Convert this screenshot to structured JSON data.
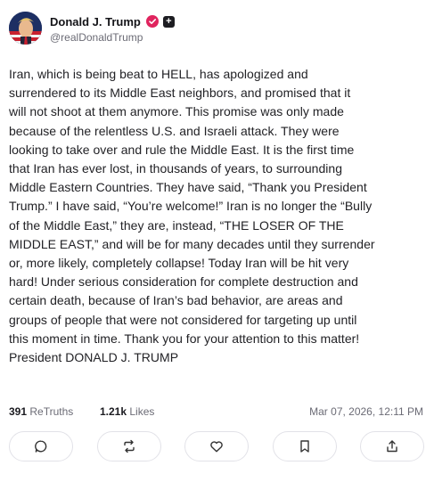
{
  "author": {
    "display_name": "Donald J. Trump",
    "handle": "@realDonaldTrump",
    "avatar_icon": "avatar-image",
    "verified_icon": "verified-badge-icon",
    "badge_label": "+"
  },
  "post": {
    "text": "Iran, which is being beat to HELL, has apologized and\nsurrendered to its Middle East neighbors, and promised that it\nwill not shoot at them anymore. This promise was only made\nbecause of the relentless U.S. and Israeli attack. They were\nlooking to take over and rule the Middle East. It is the first time\nthat Iran has ever lost, in thousands of years, to surrounding\nMiddle Eastern Countries. They have said, “Thank you President\nTrump.” I have said, “You’re welcome!” Iran is no longer the “Bully\nof the Middle East,” they are, instead, “THE LOSER OF THE\nMIDDLE EAST,” and will be for many decades until they surrender\nor, more likely, completely collapse! Today Iran will be hit very\nhard! Under serious consideration for complete destruction and\ncertain death, because of Iran’s bad behavior, are areas and\ngroups of people that were not considered for targeting up until\nthis moment in time. Thank you for your attention to this matter!\nPresident DONALD J. TRUMP"
  },
  "stats": {
    "retruths_count": "391",
    "retruths_label": "ReTruths",
    "likes_count": "1.21k",
    "likes_label": "Likes",
    "timestamp": "Mar 07, 2026, 12:11 PM"
  },
  "actions": [
    {
      "icon": "reply-icon"
    },
    {
      "icon": "retruth-icon"
    },
    {
      "icon": "like-icon"
    },
    {
      "icon": "bookmark-icon"
    },
    {
      "icon": "share-icon"
    }
  ],
  "colors": {
    "verified": "#e0245e",
    "text": "#222226",
    "muted": "#6b6b75",
    "border": "#e2e2e8"
  }
}
